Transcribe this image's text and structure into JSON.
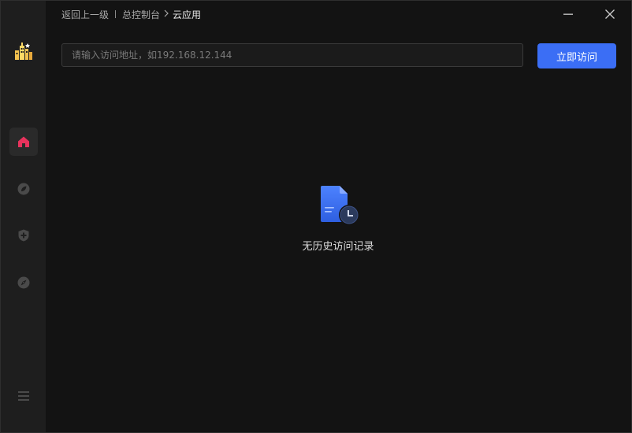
{
  "breadcrumb": {
    "back": "返回上一级",
    "parent": "总控制台",
    "current": "云应用"
  },
  "search": {
    "placeholder": "请输入访问地址，如192.168.12.144",
    "value": ""
  },
  "visit_button": {
    "label": "立即访问"
  },
  "empty_state": {
    "message": "无历史访问记录"
  },
  "sidebar": {
    "items": [
      {
        "icon": "home-icon",
        "active": true
      },
      {
        "icon": "leaf-icon",
        "active": false
      },
      {
        "icon": "shield-plus-icon",
        "active": false
      },
      {
        "icon": "compass-icon",
        "active": false
      }
    ]
  },
  "colors": {
    "accent": "#3b6ef5",
    "active_icon": "#e8335d",
    "sidebar_bg": "#1e1e1e",
    "content_bg": "#131313"
  }
}
